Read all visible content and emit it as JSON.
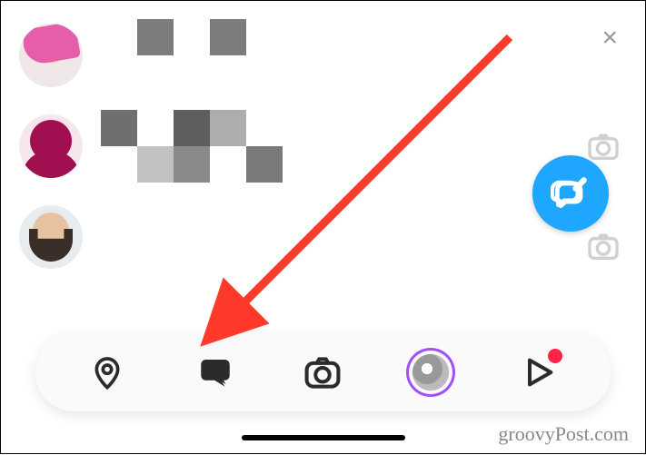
{
  "close_glyph": "×",
  "watermark": "groovyPost.com",
  "compose_icon": "compose-icon",
  "tabs": {
    "map": "map-pin-icon",
    "chat": "chat-icon",
    "camera": "camera-icon",
    "stories": "stories-icon",
    "spotlight": "play-icon"
  },
  "annotation_arrow": {
    "from": "top-right area",
    "to": "chat-tab",
    "color": "#ff3a2a"
  },
  "colors": {
    "compose_button": "#1fa6ff",
    "notification_dot": "#ff2246",
    "stories_ring": "#a050ff"
  }
}
